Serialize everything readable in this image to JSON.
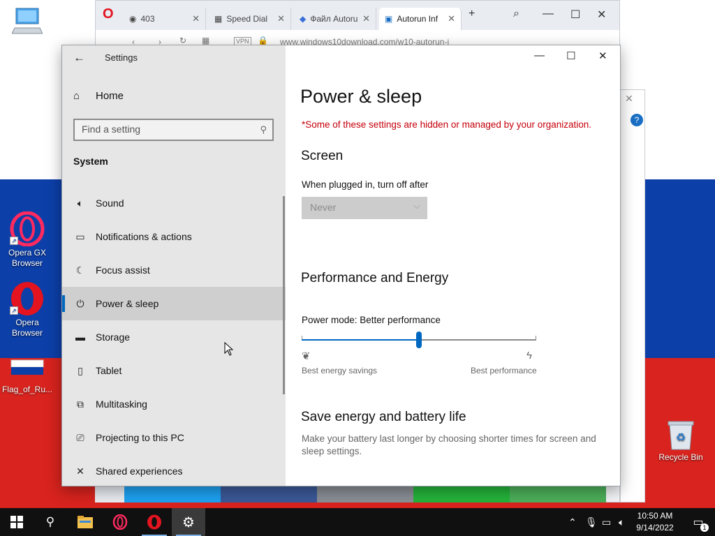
{
  "desktop": {
    "icons": [
      {
        "label": "",
        "icon": "computer-icon"
      },
      {
        "label": "Opera GX Browser",
        "icon": "opera-gx-icon"
      },
      {
        "label": "Opera Browser",
        "icon": "opera-icon"
      },
      {
        "label": "Flag_of_Ru...",
        "icon": "flag-file-icon"
      },
      {
        "label": "Recycle Bin",
        "icon": "recycle-bin-icon"
      }
    ]
  },
  "browser": {
    "tabs": [
      {
        "label": "403",
        "icon": "globe-icon"
      },
      {
        "label": "Speed Dial",
        "icon": "speed-dial-icon"
      },
      {
        "label": "Файл Autoru",
        "icon": "file-icon"
      },
      {
        "label": "Autorun Inf",
        "icon": "site-icon"
      }
    ],
    "new_tab": "+",
    "url": "www.windows10download.com/w10-autorun-i",
    "vpn_badge": "VPN",
    "help_badge": "?"
  },
  "settings": {
    "window_title": "Settings",
    "sidebar": {
      "home_label": "Home",
      "search_placeholder": "Find a setting",
      "section_title": "System",
      "items": [
        {
          "label": "Sound",
          "icon": "speaker-icon"
        },
        {
          "label": "Notifications & actions",
          "icon": "notifications-icon"
        },
        {
          "label": "Focus assist",
          "icon": "moon-icon"
        },
        {
          "label": "Power & sleep",
          "icon": "power-icon",
          "selected": true
        },
        {
          "label": "Storage",
          "icon": "storage-icon"
        },
        {
          "label": "Tablet",
          "icon": "tablet-icon"
        },
        {
          "label": "Multitasking",
          "icon": "multitasking-icon"
        },
        {
          "label": "Projecting to this PC",
          "icon": "projecting-icon"
        },
        {
          "label": "Shared experiences",
          "icon": "shared-icon"
        }
      ]
    },
    "content": {
      "title": "Power & sleep",
      "policy_warning": "*Some of these settings are hidden or managed by your organization.",
      "screen_heading": "Screen",
      "plugged_in_label": "When plugged in, turn off after",
      "plugged_in_value": "Never",
      "performance_heading": "Performance and Energy",
      "power_mode_label": "Power mode: Better performance",
      "power_mode_level": 0.5,
      "slider_min_label": "Best energy savings",
      "slider_max_label": "Best performance",
      "battery_heading": "Save energy and battery life",
      "battery_description": "Make your battery last longer by choosing shorter times for screen and sleep settings."
    }
  },
  "taskbar": {
    "apps": [
      {
        "name": "file-explorer-icon"
      },
      {
        "name": "opera-gx-icon"
      },
      {
        "name": "opera-icon"
      },
      {
        "name": "settings-icon",
        "active": true
      }
    ],
    "time": "10:50 AM",
    "date": "9/14/2022",
    "notification_count": "1"
  }
}
